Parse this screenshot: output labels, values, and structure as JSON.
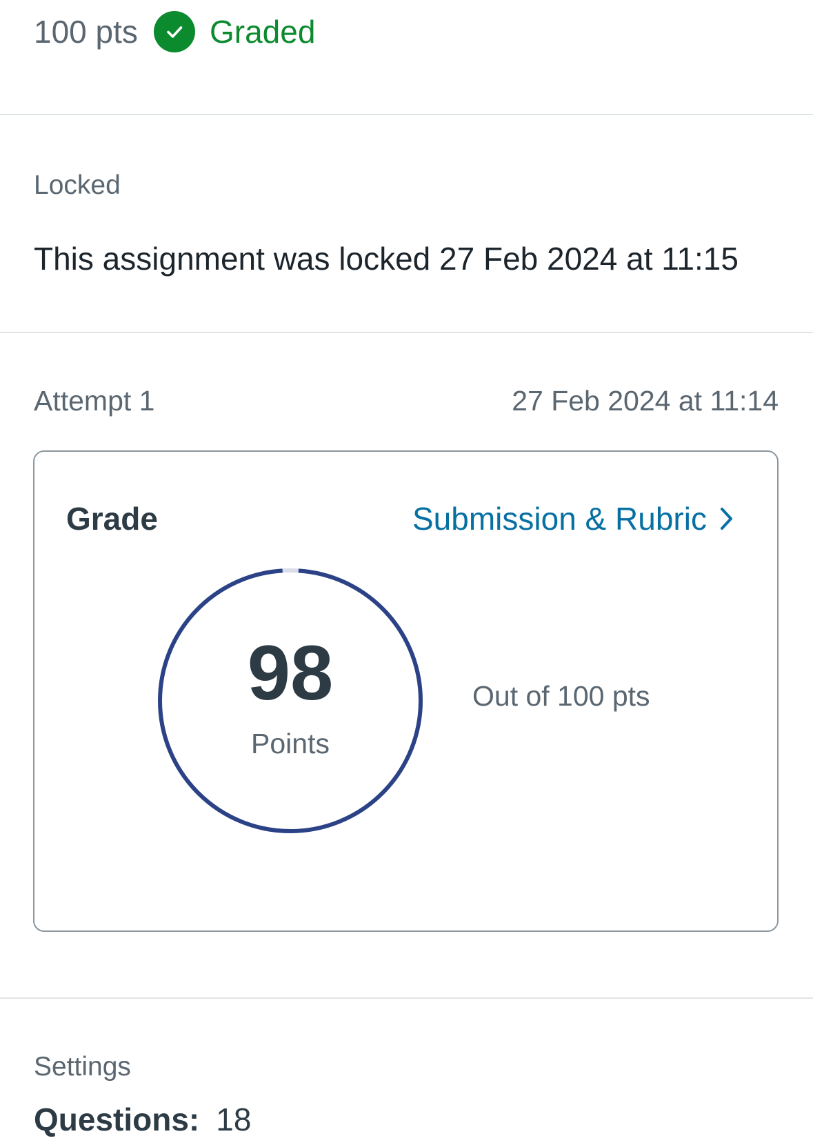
{
  "header": {
    "points": "100 pts",
    "status_label": "Graded",
    "status_icon": "check-icon",
    "status_color": "#0b8a2e"
  },
  "lock": {
    "heading": "Locked",
    "message": "This assignment was locked 27 Feb 2024 at 11:15"
  },
  "attempt": {
    "label": "Attempt 1",
    "date": "27 Feb 2024 at 11:14"
  },
  "grade": {
    "title": "Grade",
    "link_label": "Submission & Rubric",
    "link_icon": "chevron-right-icon",
    "score": "98",
    "score_unit": "Points",
    "out_of": "Out of 100 pts",
    "score_fraction": 0.98,
    "ring_color": "#2b4286",
    "ring_track_color": "#d9dde8"
  },
  "settings": {
    "heading": "Settings",
    "questions_label": "Questions:",
    "questions_value": "18"
  }
}
